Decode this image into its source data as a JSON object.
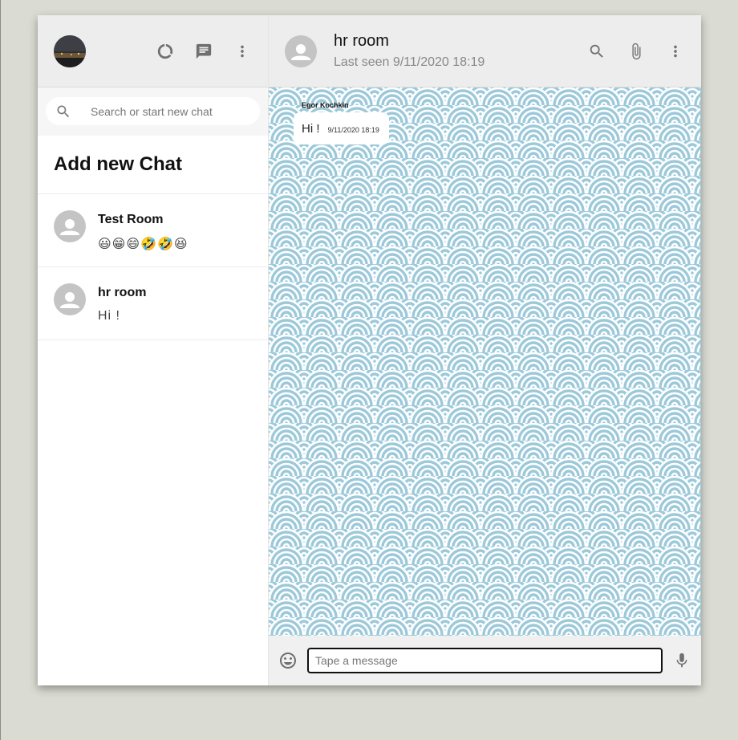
{
  "sidebar": {
    "search": {
      "placeholder": "Search or start new chat"
    },
    "add_chat_label": "Add new Chat",
    "chats": [
      {
        "name": "Test Room",
        "last_message": "😃😁😄🤣🤣😆"
      },
      {
        "name": "hr room",
        "last_message": "Hi !"
      }
    ]
  },
  "chat": {
    "header": {
      "name": "hr room",
      "last_seen": "Last seen 9/11/2020 18:19"
    },
    "messages": [
      {
        "sender": "Egor Kochkin",
        "text": "Hi !",
        "time": "9/11/2020 18:19"
      }
    ],
    "composer": {
      "placeholder": "Tape a message"
    }
  },
  "colors": {
    "pattern_bg": "#9cc9da",
    "pattern_ring": "#ffffff",
    "header_bg": "#ededed"
  },
  "icons": [
    "data-usage-icon",
    "chat-icon",
    "more-vert-icon",
    "search-icon",
    "attach-icon",
    "emoji-icon",
    "mic-icon",
    "person-icon"
  ]
}
